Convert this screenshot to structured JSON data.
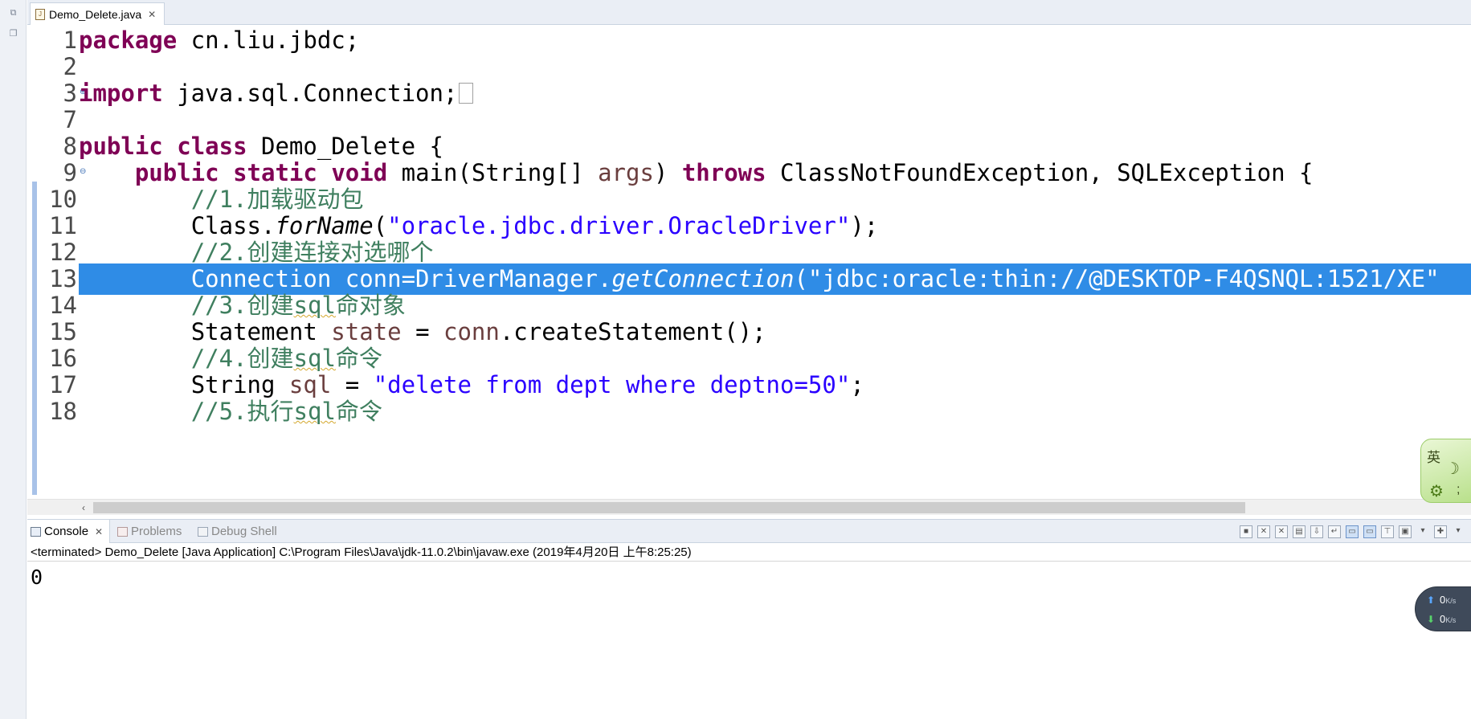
{
  "editor": {
    "tab_label": "Demo_Delete.java",
    "lines": [
      {
        "num": "1"
      },
      {
        "num": "2"
      },
      {
        "num": "3"
      },
      {
        "num": "7"
      },
      {
        "num": "8"
      },
      {
        "num": "9"
      },
      {
        "num": "10"
      },
      {
        "num": "11"
      },
      {
        "num": "12"
      },
      {
        "num": "13"
      },
      {
        "num": "14"
      },
      {
        "num": "15"
      },
      {
        "num": "16"
      },
      {
        "num": "17"
      },
      {
        "num": "18"
      }
    ],
    "code": {
      "l1_kw": "package",
      "l1_rest": " cn.liu.jbdc;",
      "l3_kw": "import",
      "l3_rest": " java.sql.Connection;",
      "l8_kw1": "public",
      "l8_kw2": "class",
      "l8_rest": " Demo_Delete {",
      "l9_kw1": "public",
      "l9_kw2": "static",
      "l9_kw3": "void",
      "l9_a": " main(String[] ",
      "l9_var": "args",
      "l9_b": ") ",
      "l9_kw4": "throws",
      "l9_c": " ClassNotFoundException, SQLException {",
      "l10_cm": "//1.加载驱动包",
      "l11_a": "Class.",
      "l11_it": "forName",
      "l11_b": "(",
      "l11_str": "\"oracle.jdbc.driver.OracleDriver\"",
      "l11_c": ");",
      "l12_cm": "//2.创建连接对选哪个",
      "l13_a": "Connection conn=DriverManager.",
      "l13_it": "getConnection",
      "l13_b": "(\"jdbc:oracle:thin://@DESKTOP-F4QSNQL:1521/XE\"",
      "l14_cm_a": "//3.创建",
      "l14_cm_sq": "sql",
      "l14_cm_b": "命对象",
      "l15_a": "Statement ",
      "l15_var": "state",
      "l15_b": " = ",
      "l15_var2": "conn",
      "l15_c": ".createStatement();",
      "l16_cm_a": "//4.创建",
      "l16_cm_sq": "sql",
      "l16_cm_b": "命令",
      "l17_a": "String ",
      "l17_var": "sql",
      "l17_b": " = ",
      "l17_str": "\"delete from dept where deptno=50\"",
      "l17_c": ";",
      "l18_cm_a": "//5.执行",
      "l18_cm_sq": "sql",
      "l18_cm_b": "命令"
    }
  },
  "console": {
    "tabs": [
      {
        "label": "Console"
      },
      {
        "label": "Problems"
      },
      {
        "label": "Debug Shell"
      }
    ],
    "header": "<terminated> Demo_Delete [Java Application] C:\\Program Files\\Java\\jdk-11.0.2\\bin\\javaw.exe (2019年4月20日 上午8:25:25)",
    "output": "0"
  },
  "ime": {
    "lang": "英",
    "moon": "☽",
    "semi": ";"
  },
  "network": {
    "up_value": "0",
    "down_value": "0",
    "unit": "K/s"
  },
  "colors": {
    "keyword": "#7f0055",
    "string": "#2a00ff",
    "comment": "#3f7f5f",
    "variable": "#6a3e3e",
    "selection": "#2f8ce6"
  }
}
